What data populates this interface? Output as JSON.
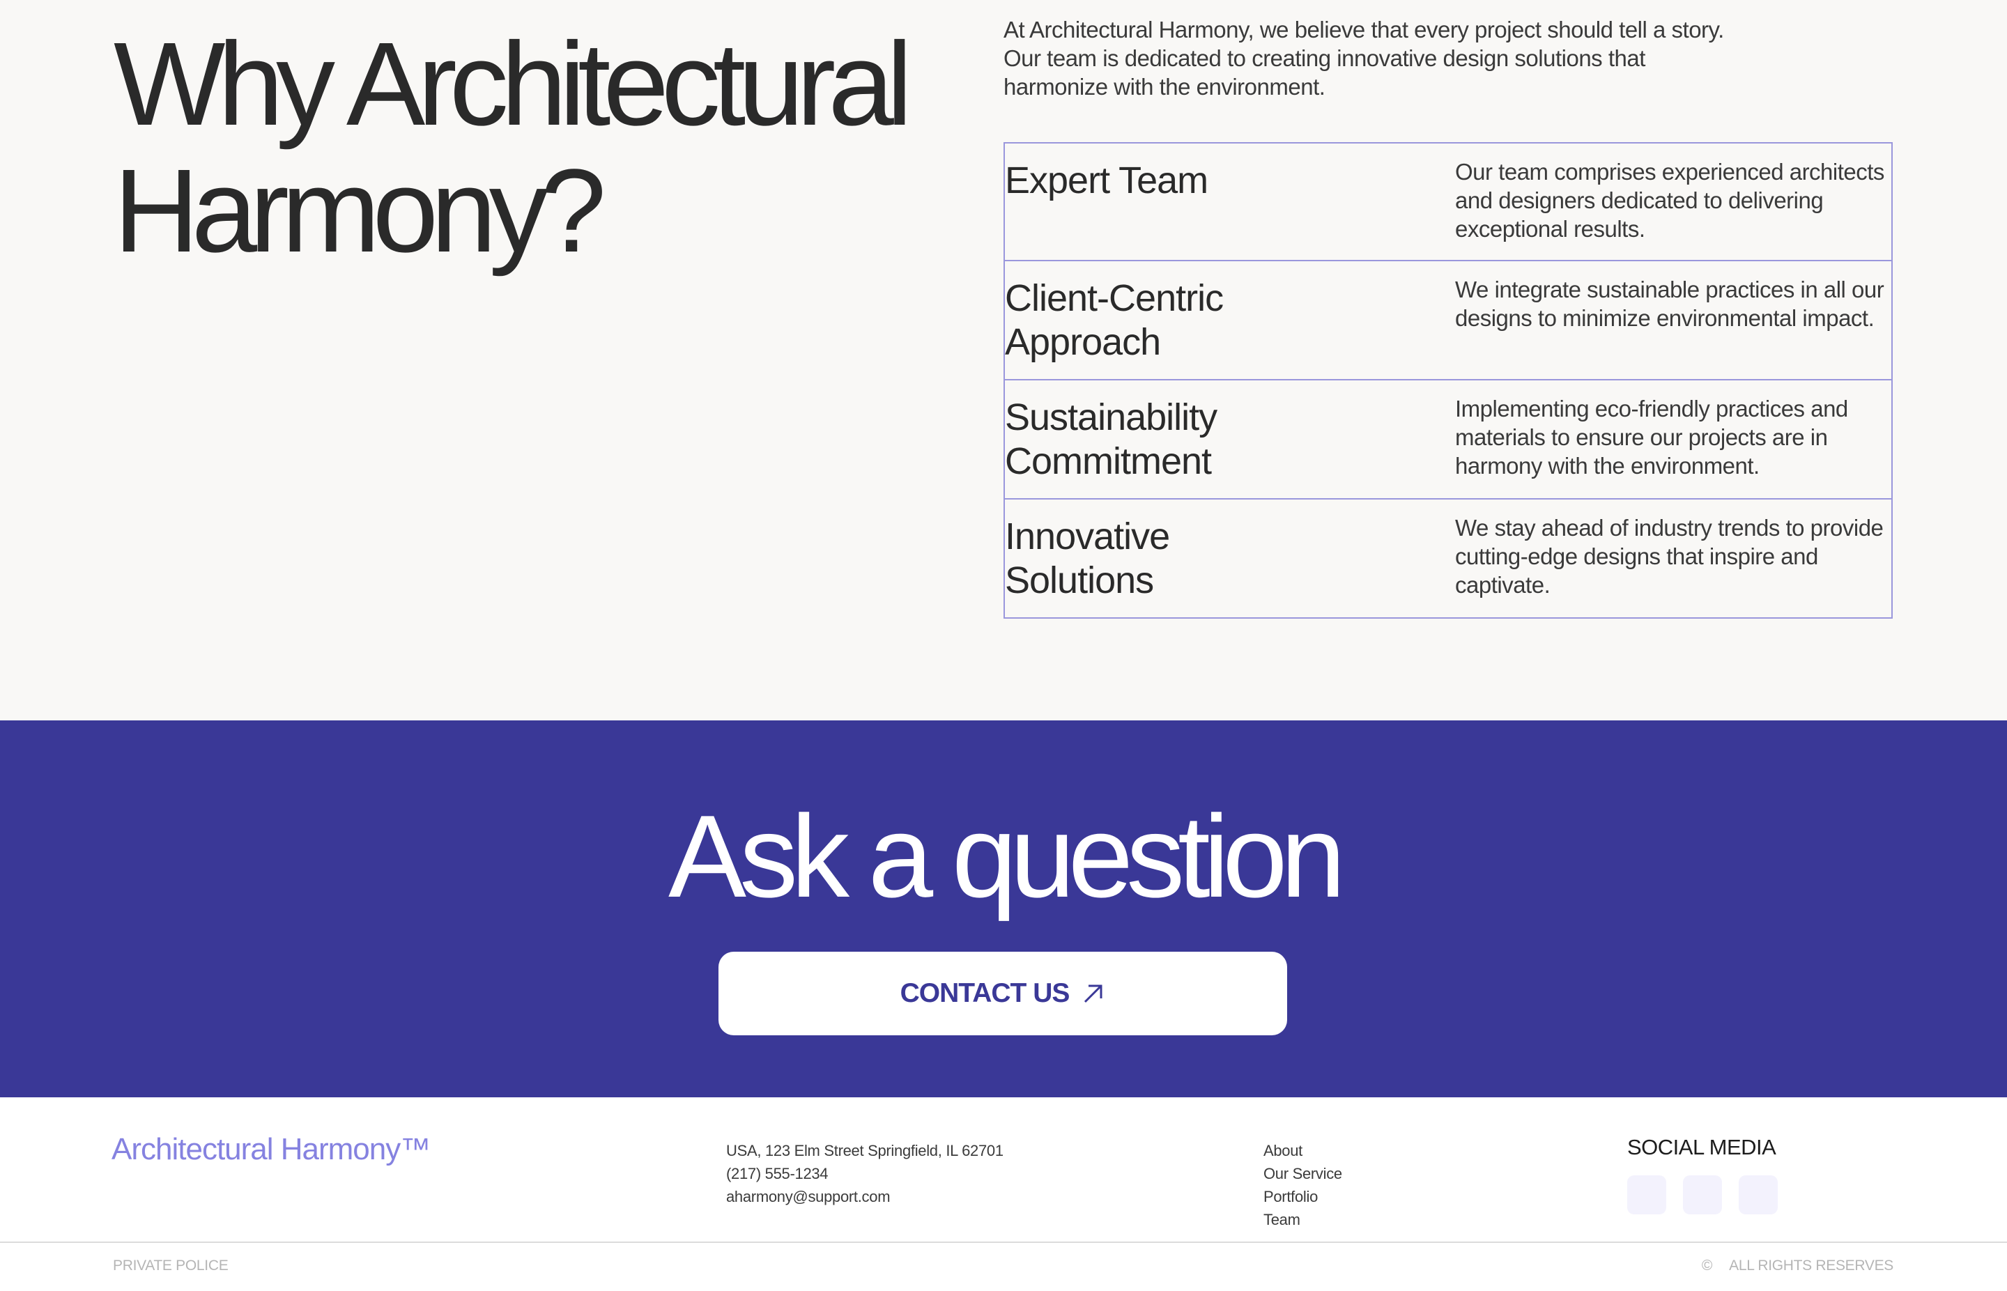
{
  "why": {
    "title": "Why Architectural Harmony?",
    "intro": "At Architectural Harmony, we believe that every project should tell a story. Our team is dedicated to creating innovative design solutions that harmonize with the environment.",
    "features": [
      {
        "title": "Expert Team",
        "desc": "Our team comprises experienced architects and designers dedicated to delivering exceptional results."
      },
      {
        "title": "Client-Centric Approach",
        "desc": "We integrate sustainable practices in all our designs to minimize environmental impact."
      },
      {
        "title": "Sustainability Commitment",
        "desc": "Implementing eco-friendly practices and materials to ensure our projects are in harmony with the environment."
      },
      {
        "title": "Innovative Solutions",
        "desc": "We stay ahead of industry trends to provide cutting-edge designs that inspire and captivate."
      }
    ]
  },
  "ask": {
    "title": "Ask a question",
    "button_label": "CONTACT US"
  },
  "footer": {
    "brand": "Architectural Harmony™",
    "address": "USA, 123 Elm Street Springfield, IL 62701",
    "phone": "(217) 555-1234",
    "email": "aharmony@support.com",
    "nav": [
      "About",
      "Our Service",
      "Portfolio",
      "Team"
    ],
    "social_title": "SOCIAL MEDIA",
    "private": "PRIVATE POLICE",
    "copyright_symbol": "©",
    "rights": "ALL RIGHTS RESERVES"
  },
  "colors": {
    "accent": "#3a3897",
    "brand": "#8582e0",
    "border": "#9a97dc",
    "background": "#f9f8f6"
  }
}
